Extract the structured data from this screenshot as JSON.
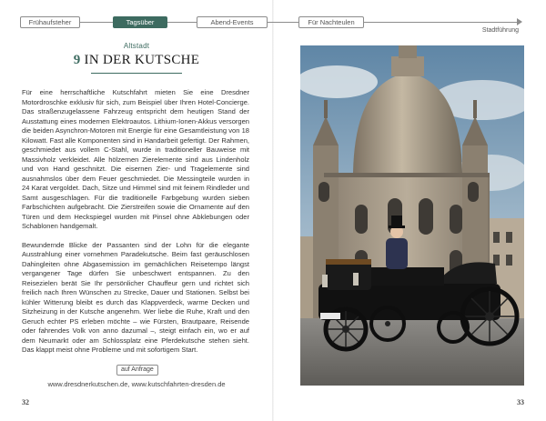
{
  "nav": {
    "tabs": [
      {
        "label": "Frühaufsteher",
        "active": false
      },
      {
        "label": "Tagsüber",
        "active": true
      },
      {
        "label": "Abend-Events",
        "active": false
      },
      {
        "label": "Für Nachteulen",
        "active": false
      }
    ],
    "section_right": "Stadtführung"
  },
  "article": {
    "district": "Altstadt",
    "number": "9",
    "title": "IN DER KUTSCHE",
    "paragraphs": [
      "Für eine herrschaftliche Kutschfahrt mieten Sie eine Dresdner Motordroschke exklusiv für sich, zum Beispiel über Ihren Hotel-Concierge. Das straßenzugelassene Fahrzeug entspricht dem heutigen Stand der Ausstattung eines modernen Elektroautos. Lithium-Ionen-Akkus versorgen die beiden Asynchron-Motoren mit Energie für eine Gesamtleistung von 18 Kilowatt. Fast alle Komponenten sind in Handarbeit gefertigt. Der Rahmen, geschmiedet aus vollem C-Stahl, wurde in traditioneller Bauweise mit Massivholz verkleidet. Alle hölzernen Zierelemente sind aus Lindenholz und von Hand geschnitzt. Die eisernen Zier- und Tragelemente sind ausnahmslos über dem Feuer geschmiedet. Die Messingteile wurden in 24 Karat vergoldet. Dach, Sitze und Himmel sind mit feinem Rindleder und Samt ausgeschlagen. Für die traditionelle Farbgebung wurden sieben Farbschichten aufgebracht. Die Zierstreifen sowie die Ornamente auf den Türen und dem Heckspiegel wurden mit Pinsel ohne Abklebungen oder Schablonen handgemalt.",
      "Bewundernde Blicke der Passanten sind der Lohn für die elegante Ausstrahlung einer vornehmen Paradekutsche. Beim fast geräuschlosen Dahingleiten ohne Abgasemission im gemächlichen Reisetempo längst vergangener Tage dürfen Sie unbeschwert entspannen. Zu den Reisezielen berät Sie Ihr persönlicher Chauffeur gern und richtet sich freilich nach Ihren Wünschen zu Strecke, Dauer und Stationen. Selbst bei kühler Witterung bleibt es durch das Klappverdeck, warme Decken und Sitzheizung in der Kutsche angenehm. Wer liebe die Ruhe, Kraft und den Geruch echter PS erleben möchte – wie Fürsten, Brautpaare, Reisende oder fahrendes Volk von anno dazumal –, steigt einfach ein, wo er auf dem Neumarkt oder am Schlossplatz eine Pferdekutsche stehen sieht. Das klappt meist ohne Probleme und mit sofortigem Start."
    ],
    "tag": "auf Anfrage",
    "websites": "www.dresdnerkutschen.de, www.kutschfahrten-dresden.de"
  },
  "pages": {
    "left": "32",
    "right": "33"
  },
  "colors": {
    "accent": "#3d6b60",
    "rule": "#8c8c8c"
  }
}
